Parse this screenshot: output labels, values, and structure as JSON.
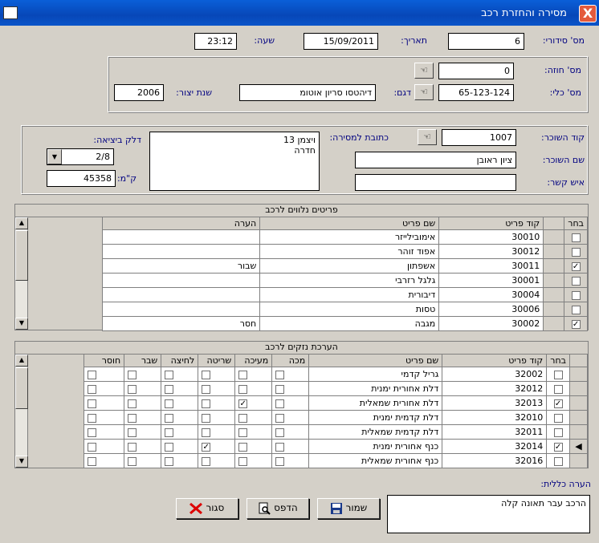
{
  "window": {
    "title": "מסירה והחזרת רכב",
    "close_label": "X"
  },
  "header": {
    "serial_label": "מס' סידורי:",
    "serial_value": "6",
    "date_label": "תאריך:",
    "date_value": "15/09/2011",
    "time_label": "שעה:",
    "time_value": "23:12"
  },
  "vehicle": {
    "contract_label": "מס' חוזה:",
    "contract_value": "0",
    "vehicle_label": "מס' כלי:",
    "vehicle_value": "65-123-124",
    "model_label": "דגם:",
    "model_value": "דיהטסו סריון אוטומ",
    "year_label": "שנת יצור:",
    "year_value": "2006"
  },
  "renter": {
    "code_label": "קוד השוכר:",
    "code_value": "1007",
    "name_label": "שם השוכר:",
    "name_value": "ציון ראובן",
    "contact_label": "איש קשר:",
    "contact_value": "",
    "address_label": "כתובת למסירה:",
    "address_line1": "ויצמן 13",
    "address_line2": "חדרה",
    "fuel_label": "דלק ביציאה:",
    "fuel_value": "2/8",
    "km_label": "ק\"מ:",
    "km_value": "45358"
  },
  "accessories": {
    "caption": "פריטים נלווים לרכב",
    "columns": [
      "בחר",
      "קוד פריט",
      "שם פריט",
      "הערה"
    ],
    "rows": [
      {
        "checked": false,
        "code": "30010",
        "name": "אימובילייזר",
        "note": ""
      },
      {
        "checked": false,
        "code": "30012",
        "name": "אפוד זוהר",
        "note": ""
      },
      {
        "checked": true,
        "code": "30011",
        "name": "אשפתון",
        "note": "שבור"
      },
      {
        "checked": false,
        "code": "30001",
        "name": "גלגל רזרבי",
        "note": ""
      },
      {
        "checked": false,
        "code": "30004",
        "name": "דיבורית",
        "note": ""
      },
      {
        "checked": false,
        "code": "30006",
        "name": "טסות",
        "note": ""
      },
      {
        "checked": true,
        "code": "30002",
        "name": "מגבה",
        "note": "חסר"
      }
    ]
  },
  "damages": {
    "caption": "הערכת נזקים לרכב",
    "columns": [
      "בחר",
      "קוד פריט",
      "שם פריט",
      "מכה",
      "מעיכה",
      "שריטה",
      "לחיצה",
      "שבר",
      "חוסר"
    ],
    "rows": [
      {
        "checked": false,
        "code": "32002",
        "name": "גריל קדמי",
        "flags": [
          false,
          false,
          false,
          false,
          false,
          false
        ]
      },
      {
        "checked": false,
        "code": "32012",
        "name": "דלת אחורית ימנית",
        "flags": [
          false,
          false,
          false,
          false,
          false,
          false
        ]
      },
      {
        "checked": true,
        "code": "32013",
        "name": "דלת אחורית שמאלית",
        "flags": [
          false,
          true,
          false,
          false,
          false,
          false
        ]
      },
      {
        "checked": false,
        "code": "32010",
        "name": "דלת קדמית ימנית",
        "flags": [
          false,
          false,
          false,
          false,
          false,
          false
        ]
      },
      {
        "checked": false,
        "code": "32011",
        "name": "דלת קדמית שמאלית",
        "flags": [
          false,
          false,
          false,
          false,
          false,
          false
        ]
      },
      {
        "checked": true,
        "code": "32014",
        "name": "כנף אחורית ימנית",
        "flags": [
          false,
          false,
          true,
          false,
          false,
          false
        ]
      },
      {
        "checked": false,
        "code": "32016",
        "name": "כנף אחורית שמאלית",
        "flags": [
          false,
          false,
          false,
          false,
          false,
          false
        ]
      }
    ]
  },
  "general_note": {
    "label": "הערה כללית:",
    "value": "הרכב עבר תאונה קלה"
  },
  "buttons": {
    "save": "שמור",
    "print": "הדפס",
    "close": "סגור"
  }
}
